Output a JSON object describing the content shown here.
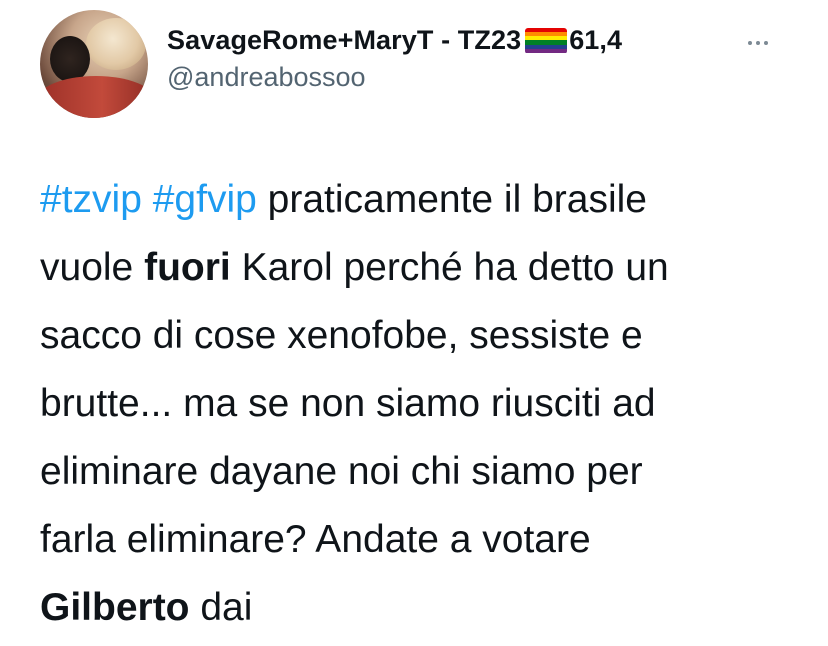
{
  "tweet": {
    "display_name": "SavageRome+MaryT - TZ23",
    "name_suffix": "61,4",
    "flag_icon": "rainbow-flag-icon",
    "flag_colors": [
      "#e40303",
      "#ff8c00",
      "#ffed00",
      "#008026",
      "#24408e",
      "#732982"
    ],
    "handle": "@andreabossoo",
    "more_icon": "more-options-icon",
    "hashtag_color": "#1d9bf0",
    "lines": [
      {
        "hashtag1": "#tzvip",
        "hashtag2": "#gfvip",
        "text": " praticamente il brasile"
      },
      {
        "text_before": "vuole ",
        "bold": "fuori",
        "text_after": " Karol perché ha detto un"
      },
      {
        "text": "sacco di cose xenofobe, sessiste e"
      },
      {
        "text": "brutte... ma se non siamo riusciti ad"
      },
      {
        "text": "eliminare dayane noi chi siamo per"
      },
      {
        "text": "farla eliminare? Andate a votare"
      },
      {
        "bold": "Gilberto",
        "text_after": " dai"
      }
    ]
  }
}
